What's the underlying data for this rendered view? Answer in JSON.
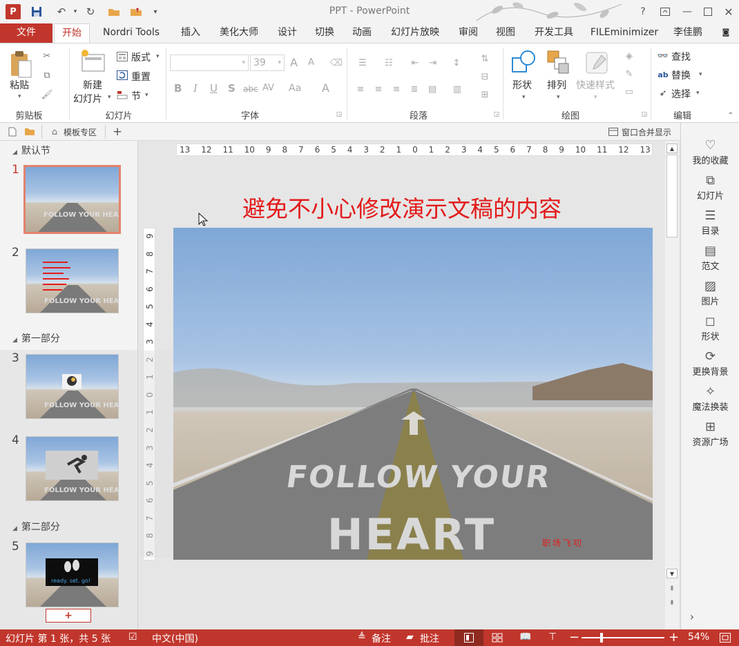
{
  "app": {
    "window_title": "PPT - PowerPoint",
    "user": "李佳鹏",
    "logo_letter": "P"
  },
  "tabs": [
    "文件",
    "开始",
    "Nordri Tools",
    "插入",
    "美化大师",
    "设计",
    "切换",
    "动画",
    "幻灯片放映",
    "审阅",
    "视图",
    "开发工具",
    "FILEminimizer"
  ],
  "ribbon": {
    "clipboard": {
      "paste": "粘贴",
      "label": "剪贴板"
    },
    "slides": {
      "new_slide": "新建",
      "new_slide2": "幻灯片",
      "layout": "版式",
      "reset": "重置",
      "section": "节",
      "label": "幻灯片"
    },
    "font": {
      "size": "39",
      "bold": "B",
      "italic": "I",
      "underline": "U",
      "shadow": "S",
      "strike": "abc",
      "spacing": "AV",
      "case": "Aa",
      "color": "A",
      "grow": "A",
      "shrink": "A",
      "label": "字体"
    },
    "paragraph": {
      "label": "段落"
    },
    "drawing": {
      "shapes": "形状",
      "arrange": "排列",
      "quick_styles": "快速样式",
      "label": "绘图"
    },
    "editing": {
      "find": "查找",
      "replace": "替换",
      "select": "选择",
      "label": "编辑"
    }
  },
  "panelbar": {
    "template_zone": "模板专区",
    "merge_windows": "窗口合并显示"
  },
  "thumbnails": {
    "sections": [
      "默认节",
      "第一部分",
      "第二部分"
    ],
    "slides": [
      {
        "num": "1",
        "text": "FOLLOW YOUR HEART"
      },
      {
        "num": "2",
        "text": "FOLLOW YOUR HEART"
      },
      {
        "num": "3",
        "text": "FOLLOW YOUR HEART"
      },
      {
        "num": "4",
        "text": "FOLLOW YOUR HEART"
      },
      {
        "num": "5",
        "text": "ready. set. go!"
      }
    ],
    "add_button": "+"
  },
  "slide": {
    "title": "避免不小心修改演示文稿的内容",
    "road_text_1": "FOLLOW YOUR",
    "road_text_2": "HEART",
    "watermark": "职场飞叨",
    "title_color": "#e31b1b"
  },
  "ruler": {
    "horizontal": [
      "13",
      "12",
      "11",
      "10",
      "9",
      "8",
      "7",
      "6",
      "5",
      "4",
      "3",
      "2",
      "1",
      "0",
      "1",
      "2",
      "3",
      "4",
      "5",
      "6",
      "7",
      "8",
      "9",
      "10",
      "11",
      "12",
      "13"
    ],
    "vertical": [
      "9",
      "8",
      "7",
      "6",
      "5",
      "4",
      "3",
      "2",
      "1",
      "0",
      "1",
      "2",
      "3",
      "4",
      "5",
      "6",
      "7",
      "8",
      "9"
    ]
  },
  "right_pane": [
    "我的收藏",
    "幻灯片",
    "目录",
    "范文",
    "图片",
    "形状",
    "更换背景",
    "魔法换装",
    "资源广场"
  ],
  "status": {
    "slide_info": "幻灯片 第 1 张，共 5 张",
    "language": "中文(中国)",
    "notes": "备注",
    "comments": "批注",
    "zoom": "54%"
  },
  "colors": {
    "accent": "#c1362c",
    "thumb_selected": "#e4826d"
  }
}
